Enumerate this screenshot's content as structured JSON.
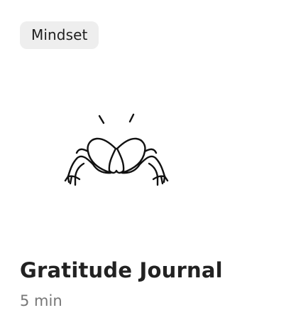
{
  "card": {
    "tag": "Mindset",
    "illustration_icon": "heart-hands-icon",
    "title": "Gratitude Journal",
    "duration": "5 min"
  },
  "colors": {
    "background": "#ffffff",
    "tag_background": "#eeeeee",
    "title": "#222222",
    "duration": "#777777",
    "icon_stroke": "#111111"
  }
}
